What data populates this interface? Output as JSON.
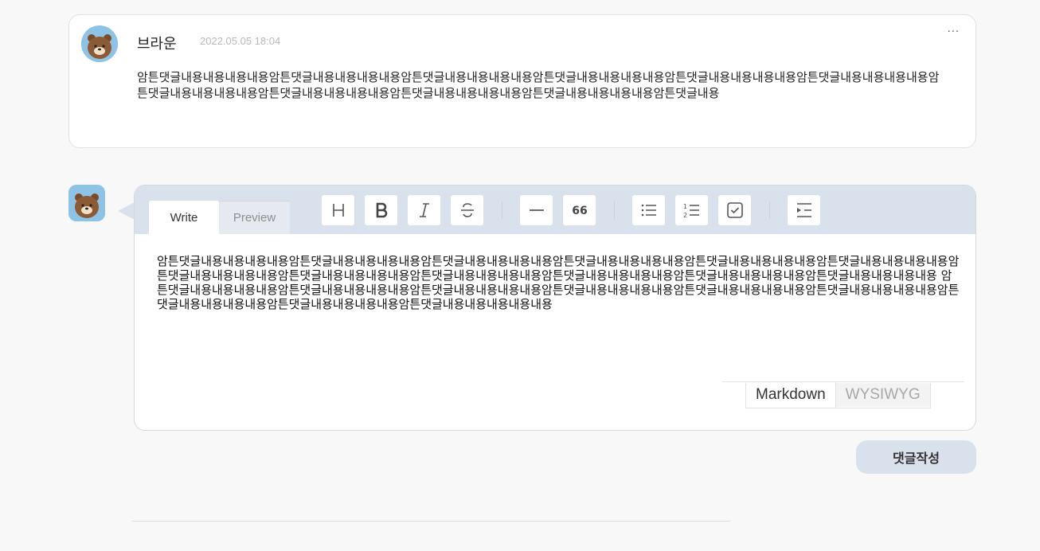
{
  "comment": {
    "author": "브라운",
    "date": "2022.05.05 18:04",
    "more_label": "···",
    "body": "암튼댓글내용내용내용내용암튼댓글내용내용내용내용암튼댓글내용내용내용내용암튼댓글내용내용내용내용암튼댓글내용내용내용내용암튼댓글내용내용내용내용암튼댓글내용내용내용내용암튼댓글내용내용내용내용암튼댓글내용내용내용내용암튼댓글내용내용내용내용암튼댓글내용",
    "avatar_icon": "brown-bear-avatar-icon"
  },
  "editor": {
    "tabs": {
      "write": "Write",
      "preview": "Preview"
    },
    "toolbar_icons": [
      "heading-icon",
      "bold-icon",
      "italic-icon",
      "strikethrough-icon",
      "horizontal-line-icon",
      "quote-icon",
      "bullet-list-icon",
      "ordered-list-icon",
      "task-list-icon",
      "indent-icon"
    ],
    "content": "암튼댓글내용내용내용내용암튼댓글내용내용내용내용암튼댓글내용내용내용내용암튼댓글내용내용내용내용암튼댓글내용내용내용내용암튼댓글내용내용내용내용암튼댓글내용내용내용내용암튼댓글내용내용내용내용암튼댓글내용내용내용내용암튼댓글내용내용내용내용암튼댓글내용내용내용내용암튼댓글내용내용내용내용 암튼댓글내용내용내용내용암튼댓글내용내용내용내용암튼댓글내용내용내용내용암튼댓글내용내용내용내용암튼댓글내용내용내용내용암튼댓글내용내용내용내용암튼댓글내용내용내용내용암튼댓글내용내용내용내용암튼댓글내용내용내용내용내용",
    "modes": {
      "markdown": "Markdown",
      "wysiwyg": "WYSIWYG"
    },
    "active_mode": "Markdown"
  },
  "submit_label": "댓글작성",
  "colors": {
    "toolbar_bg": "#d8e1ec",
    "submit_bg": "#d8e1ec",
    "avatar_bg": "#8ec3e6"
  }
}
